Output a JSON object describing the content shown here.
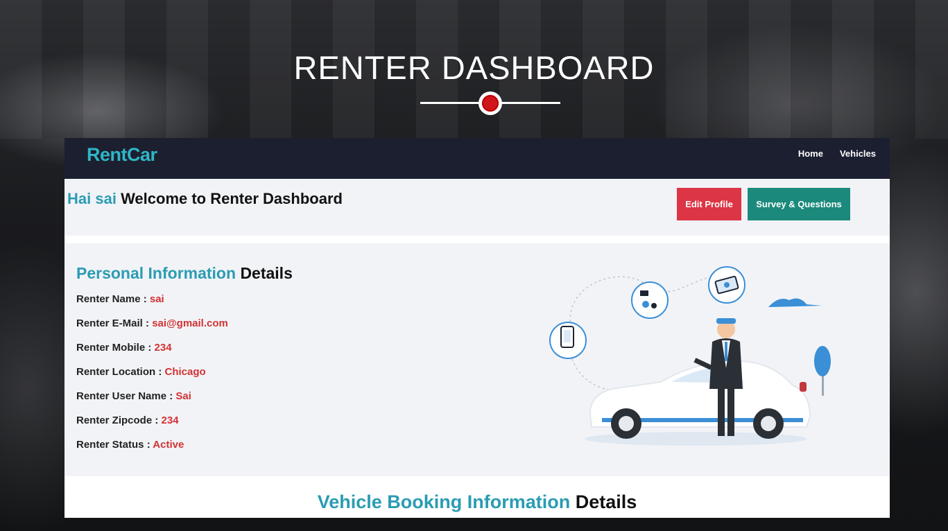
{
  "hero": {
    "title": "RENTER DASHBOARD"
  },
  "navbar": {
    "brand": "RentCar",
    "links": [
      {
        "label": "Home"
      },
      {
        "label": "Vehicles"
      }
    ]
  },
  "welcome": {
    "greeting": "Hai sai",
    "message": "Welcome to Renter Dashboard",
    "edit_profile_label": "Edit Profile",
    "survey_label": "Survey & Questions"
  },
  "personal_info": {
    "title_accent": "Personal Information",
    "title_rest": "Details",
    "rows": [
      {
        "label": "Renter Name : ",
        "value": "sai"
      },
      {
        "label": "Renter E-Mail : ",
        "value": "sai@gmail.com"
      },
      {
        "label": "Renter Mobile : ",
        "value": "234"
      },
      {
        "label": "Renter Location : ",
        "value": "Chicago"
      },
      {
        "label": "Renter User Name : ",
        "value": "Sai"
      },
      {
        "label": "Renter Zipcode : ",
        "value": "234"
      },
      {
        "label": "Renter Status : ",
        "value": "Active"
      }
    ]
  },
  "booking": {
    "title_accent": "Vehicle Booking Information",
    "title_rest": "Details"
  },
  "colors": {
    "accent": "#2a9cb2",
    "value_red": "#d23232",
    "edit_button": "#dc3545",
    "survey_button": "#1b8a7c",
    "navbar": "#1c1f2f"
  }
}
